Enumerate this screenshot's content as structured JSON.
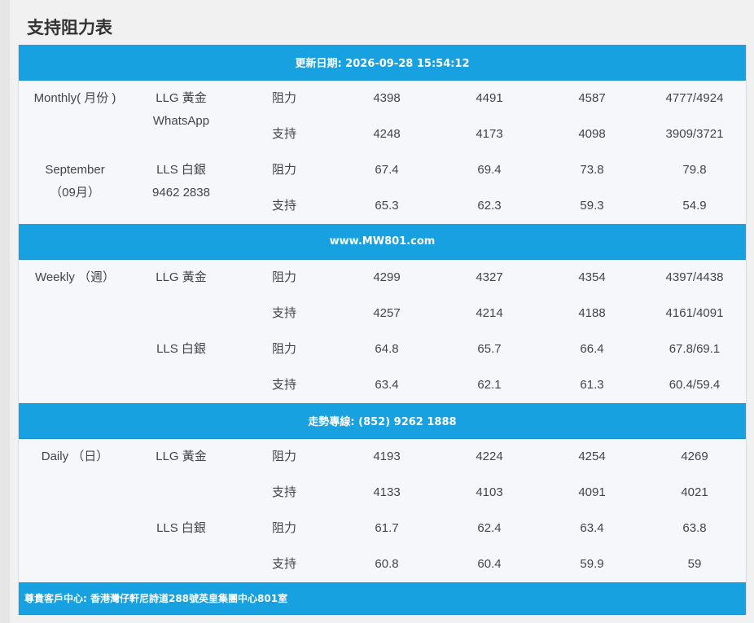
{
  "page": {
    "title": "支持阻力表"
  },
  "banners": {
    "updated": "更新日期: 2026-09-28 15:54:12",
    "website": "www.MW801.com",
    "hotline": "走勢專線: (852) 9262 1888",
    "footer": "尊貴客戶中心: 香港灣仔軒尼詩道288號英皇集團中心801室"
  },
  "monthly": {
    "period_line1": "Monthly( 月份 )",
    "period_line2": "September",
    "period_line3": "（09月）",
    "gold_label": "LLG 黃金",
    "gold_extra": "WhatsApp",
    "silver_label": "LLS 白銀",
    "silver_extra": "9462 2838",
    "rows": [
      {
        "type": "阻力",
        "v1": "4398",
        "v2": "4491",
        "v3": "4587",
        "v4": "4777/4924"
      },
      {
        "type": "支持",
        "v1": "4248",
        "v2": "4173",
        "v3": "4098",
        "v4": "3909/3721"
      },
      {
        "type": "阻力",
        "v1": "67.4",
        "v2": "69.4",
        "v3": "73.8",
        "v4": "79.8"
      },
      {
        "type": "支持",
        "v1": "65.3",
        "v2": "62.3",
        "v3": "59.3",
        "v4": "54.9"
      }
    ]
  },
  "weekly": {
    "period": "Weekly （週）",
    "gold_label": "LLG 黃金",
    "silver_label": "LLS 白銀",
    "rows": [
      {
        "type": "阻力",
        "v1": "4299",
        "v2": "4327",
        "v3": "4354",
        "v4": "4397/4438"
      },
      {
        "type": "支持",
        "v1": "4257",
        "v2": "4214",
        "v3": "4188",
        "v4": "4161/4091"
      },
      {
        "type": "阻力",
        "v1": "64.8",
        "v2": "65.7",
        "v3": "66.4",
        "v4": "67.8/69.1"
      },
      {
        "type": "支持",
        "v1": "63.4",
        "v2": "62.1",
        "v3": "61.3",
        "v4": "60.4/59.4"
      }
    ]
  },
  "daily": {
    "period": "Daily （日）",
    "gold_label": "LLG 黃金",
    "silver_label": "LLS 白銀",
    "rows": [
      {
        "type": "阻力",
        "v1": "4193",
        "v2": "4224",
        "v3": "4254",
        "v4": "4269"
      },
      {
        "type": "支持",
        "v1": "4133",
        "v2": "4103",
        "v3": "4091",
        "v4": "4021"
      },
      {
        "type": "阻力",
        "v1": "61.7",
        "v2": "62.4",
        "v3": "63.4",
        "v4": "63.8"
      },
      {
        "type": "支持",
        "v1": "60.8",
        "v2": "60.4",
        "v3": "59.9",
        "v4": "59"
      }
    ]
  }
}
